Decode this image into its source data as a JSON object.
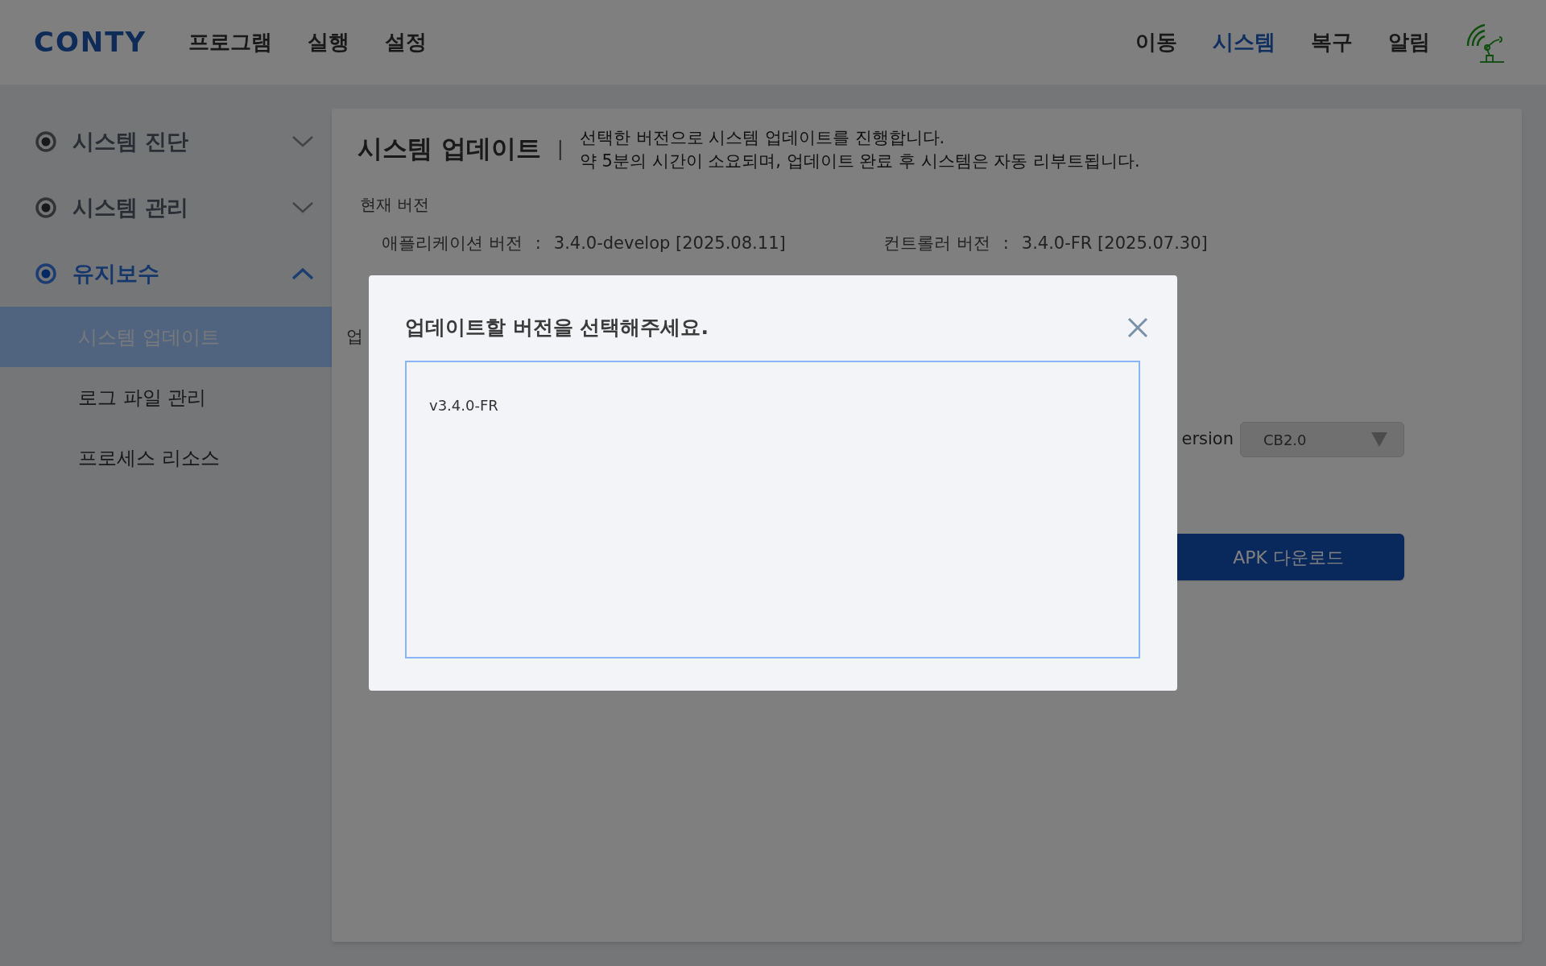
{
  "top_nav": {
    "logo": "CONTY",
    "left_menu": [
      {
        "label": "프로그램",
        "selected": false
      },
      {
        "label": "실행",
        "selected": false
      },
      {
        "label": "설정",
        "selected": false
      }
    ],
    "right_menu": [
      {
        "label": "이동",
        "selected": false
      },
      {
        "label": "시스템",
        "selected": true
      },
      {
        "label": "복구",
        "selected": false
      },
      {
        "label": "알림",
        "selected": false
      }
    ]
  },
  "sidebar": {
    "groups": [
      {
        "label": "시스템 진단",
        "selected": false,
        "expanded": false
      },
      {
        "label": "시스템 관리",
        "selected": false,
        "expanded": false
      },
      {
        "label": "유지보수",
        "selected": true,
        "expanded": true,
        "children": [
          {
            "label": "시스템 업데이트",
            "selected": true
          },
          {
            "label": "로그 파일 관리",
            "selected": false
          },
          {
            "label": "프로세스 리소스",
            "selected": false
          }
        ]
      }
    ]
  },
  "page": {
    "title": "시스템 업데이트",
    "title_divider": "|",
    "description": [
      "선택한 버전으로 시스템 업데이트를 진행합니다.",
      "약 5분의 시간이 소요되며, 업데이트 완료 후 시스템은 자동 리부트됩니다."
    ],
    "current_version": {
      "heading": "현재 버전",
      "items": [
        {
          "label": "애플리케이션 버전",
          "colon": ":",
          "value": "3.4.0-develop [2025.08.11]"
        },
        {
          "label": "컨트롤러 버전",
          "colon": ":",
          "value": "3.4.0-FR [2025.07.30]"
        }
      ]
    },
    "partial_label": "업",
    "board_version": {
      "label": "ersion",
      "value": "CB2.0"
    },
    "apk_button": "APK 다운로드"
  },
  "dialog": {
    "title": "업데이트할 버전을 선택해주세요.",
    "options": [
      {
        "label": "v3.4.0-FR",
        "selected": false
      }
    ]
  }
}
